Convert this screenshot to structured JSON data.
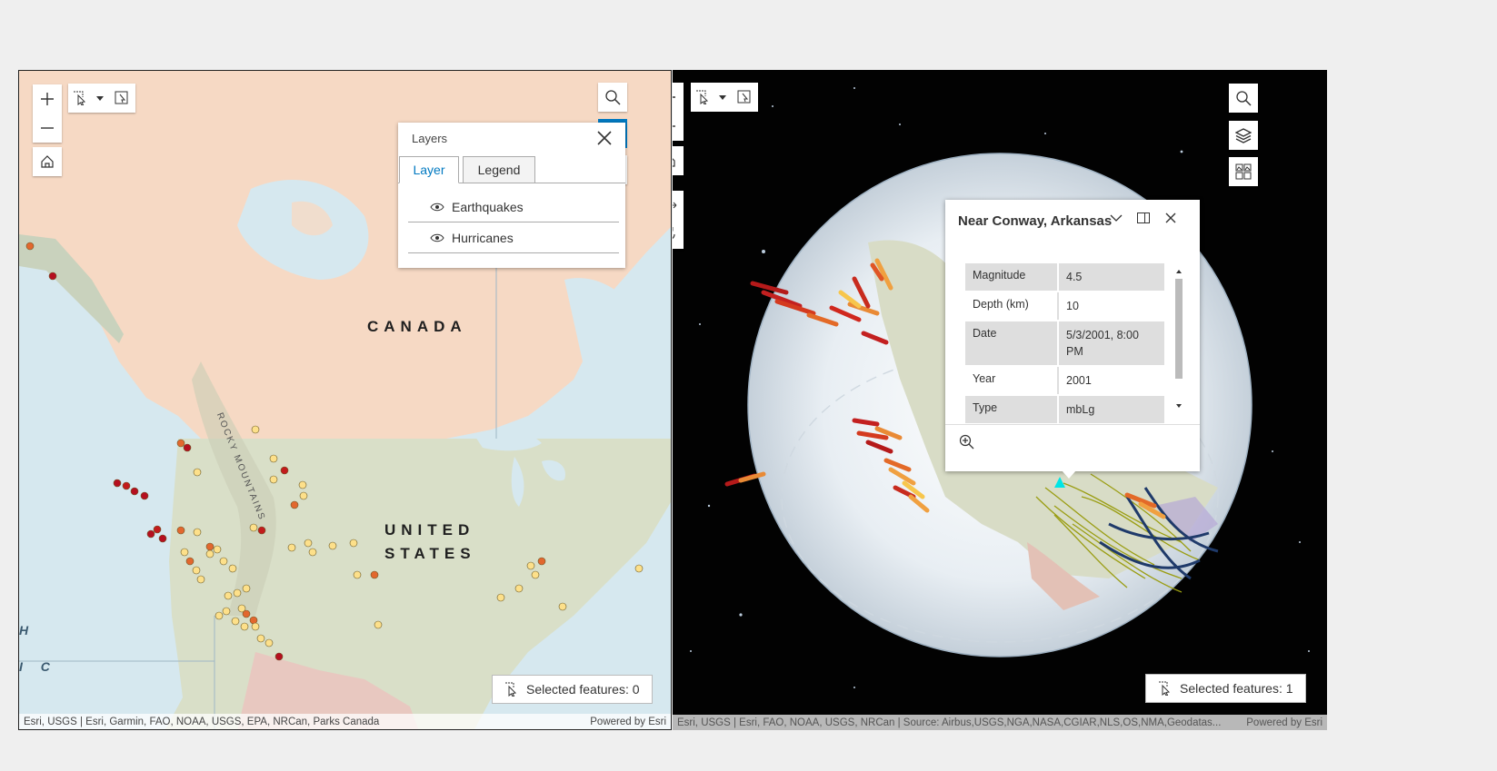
{
  "map2d": {
    "labels": {
      "canada": "CANADA",
      "us_line1": "UNITED",
      "us_line2": "STATES",
      "rockies": "ROCKY MOUNTAINS",
      "edge1": "H",
      "edge2": "I C"
    },
    "layers_panel": {
      "title": "Layers",
      "tabs": [
        "Layer",
        "Legend"
      ],
      "active_tab": "Layer",
      "items": [
        "Earthquakes",
        "Hurricanes"
      ]
    },
    "selected_features": "Selected features: 0",
    "attribution": "Esri, USGS | Esri, Garmin, FAO, NOAA, USGS, EPA, NRCan, Parks Canada",
    "powered_by": "Powered by Esri",
    "colors": {
      "land_canada": "#f6d9c4",
      "land_us": "#d9dfc8",
      "water": "#d6e8ef",
      "accent": "#0079c1"
    }
  },
  "map3d": {
    "popup": {
      "title": "Near Conway, Arkansas",
      "rows": [
        {
          "k": "Magnitude",
          "v": "4.5"
        },
        {
          "k": "Depth (km)",
          "v": "10"
        },
        {
          "k": "Date",
          "v": "5/3/2001, 8:00 PM"
        },
        {
          "k": "Year",
          "v": "2001"
        },
        {
          "k": "Type",
          "v": "mbLg"
        }
      ]
    },
    "selected_features": "Selected features: 1",
    "attribution": "Esri, USGS | Esri, FAO, NOAA, USGS, NRCan | Source: Airbus,USGS,NGA,NASA,CGIAR,NLS,OS,NMA,Geodatas...",
    "powered_by": "Powered by Esri"
  }
}
